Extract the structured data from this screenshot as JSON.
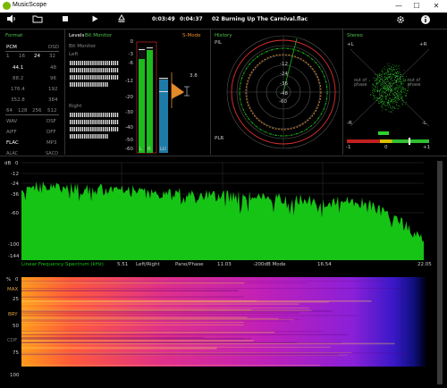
{
  "window": {
    "title": "MusicScope"
  },
  "window_controls": {
    "minimize": "—",
    "maximize": "☐",
    "close": "✕"
  },
  "toolbar": {
    "volume_icon": "speaker-icon",
    "open_icon": "folder-icon",
    "stop_icon": "stop-icon",
    "play_icon": "play-icon",
    "export_icon": "export-icon",
    "elapsed": "0:03:49",
    "separator": "/",
    "duration": "0:04:37",
    "track": "02 Burning Up The Carnival.flac",
    "settings_icon": "gear-icon",
    "info_icon": "info-icon"
  },
  "format_panel": {
    "title": "Format",
    "pcm_label": "PCM",
    "dsd_label": "DSD",
    "bits": [
      "1",
      "16",
      "24",
      "32"
    ],
    "rates": [
      {
        "pcm": "44.1",
        "dsd": "48"
      },
      {
        "pcm": "88.2",
        "dsd": "96"
      },
      {
        "pcm": "176.4",
        "dsd": "192"
      },
      {
        "pcm": "352.8",
        "dsd": "384"
      }
    ],
    "dsd_rates": [
      "64",
      "128",
      "256",
      "512"
    ],
    "codecs": [
      {
        "left": "WAV",
        "right": "DSF"
      },
      {
        "left": "AIFF",
        "right": "DFF"
      },
      {
        "left": "FLAC",
        "right": "MP3"
      },
      {
        "left": "ALAC",
        "right": "SACD"
      }
    ]
  },
  "levels_panel": {
    "title": "Levels",
    "bit_monitor_tab": "Bit Monitor",
    "smode": "S-Mode",
    "bit_monitor_label": "Bit Monitor",
    "left_label": "Left",
    "right_label": "Right",
    "scale": [
      "0",
      "-3",
      "-6",
      "-12",
      "-20",
      "-30",
      "-40",
      "-50",
      "-60"
    ],
    "channel_labels": [
      "L",
      "R",
      "LU"
    ],
    "ratio_value": "3.8"
  },
  "history_panel": {
    "title": "History",
    "pil_label": "PIL",
    "plr_label": "PLR",
    "rings": [
      "-12",
      "-24",
      "-36",
      "-48",
      "-60"
    ]
  },
  "stereo_panel": {
    "title": "Stereo",
    "plus_l": "+L",
    "plus_r": "+R",
    "minus_l": "-R",
    "minus_r": "-L",
    "out_of_phase_left": "out of phase",
    "out_of_phase_right": "out of phase",
    "correlation_min": "-1",
    "correlation_mid": "0",
    "correlation_max": "+1"
  },
  "spectrum": {
    "db_unit": "dB",
    "y_ticks": [
      "0",
      "-12",
      "-24",
      "-36",
      "-60",
      "-100",
      "-144"
    ],
    "x_ticks": [
      "5.51",
      "11.03",
      "16.54",
      "22.05"
    ],
    "caption": "Linear Frequency Spectrum (kHz)",
    "mode_left_right": "Left/Right",
    "mode_pano": "Pano/Phase",
    "mode_20k": "-200dB Mode",
    "fill_color": "#16c416",
    "peak_color": "#e0a040"
  },
  "spectrogram": {
    "percent_unit": "%",
    "y_ticks": [
      "0",
      "25",
      "50",
      "75",
      "100"
    ],
    "markers": [
      "MAX",
      "BRY",
      "CDF"
    ]
  }
}
